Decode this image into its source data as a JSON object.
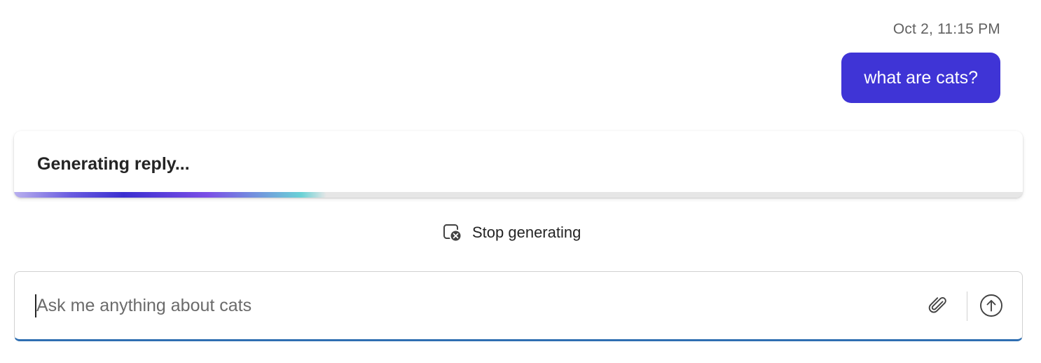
{
  "conversation": {
    "timestamp": "Oct 2, 11:15 PM",
    "user_message": "what are cats?"
  },
  "reply": {
    "status_text": "Generating reply...",
    "progress_fraction": 0.31,
    "progress_colors": [
      "#b9b0ee",
      "#3b2fd0",
      "#7b4fe6",
      "#6ad2d6"
    ]
  },
  "controls": {
    "stop_label": "Stop generating",
    "stop_icon": "stop-generating-icon"
  },
  "composer": {
    "placeholder": "Ask me anything about cats",
    "value": "",
    "attach_icon": "paperclip-icon",
    "send_icon": "arrow-up-circle-icon"
  },
  "colors": {
    "user_bubble": "#3f34d6",
    "input_underline": "#2f6fb2"
  }
}
